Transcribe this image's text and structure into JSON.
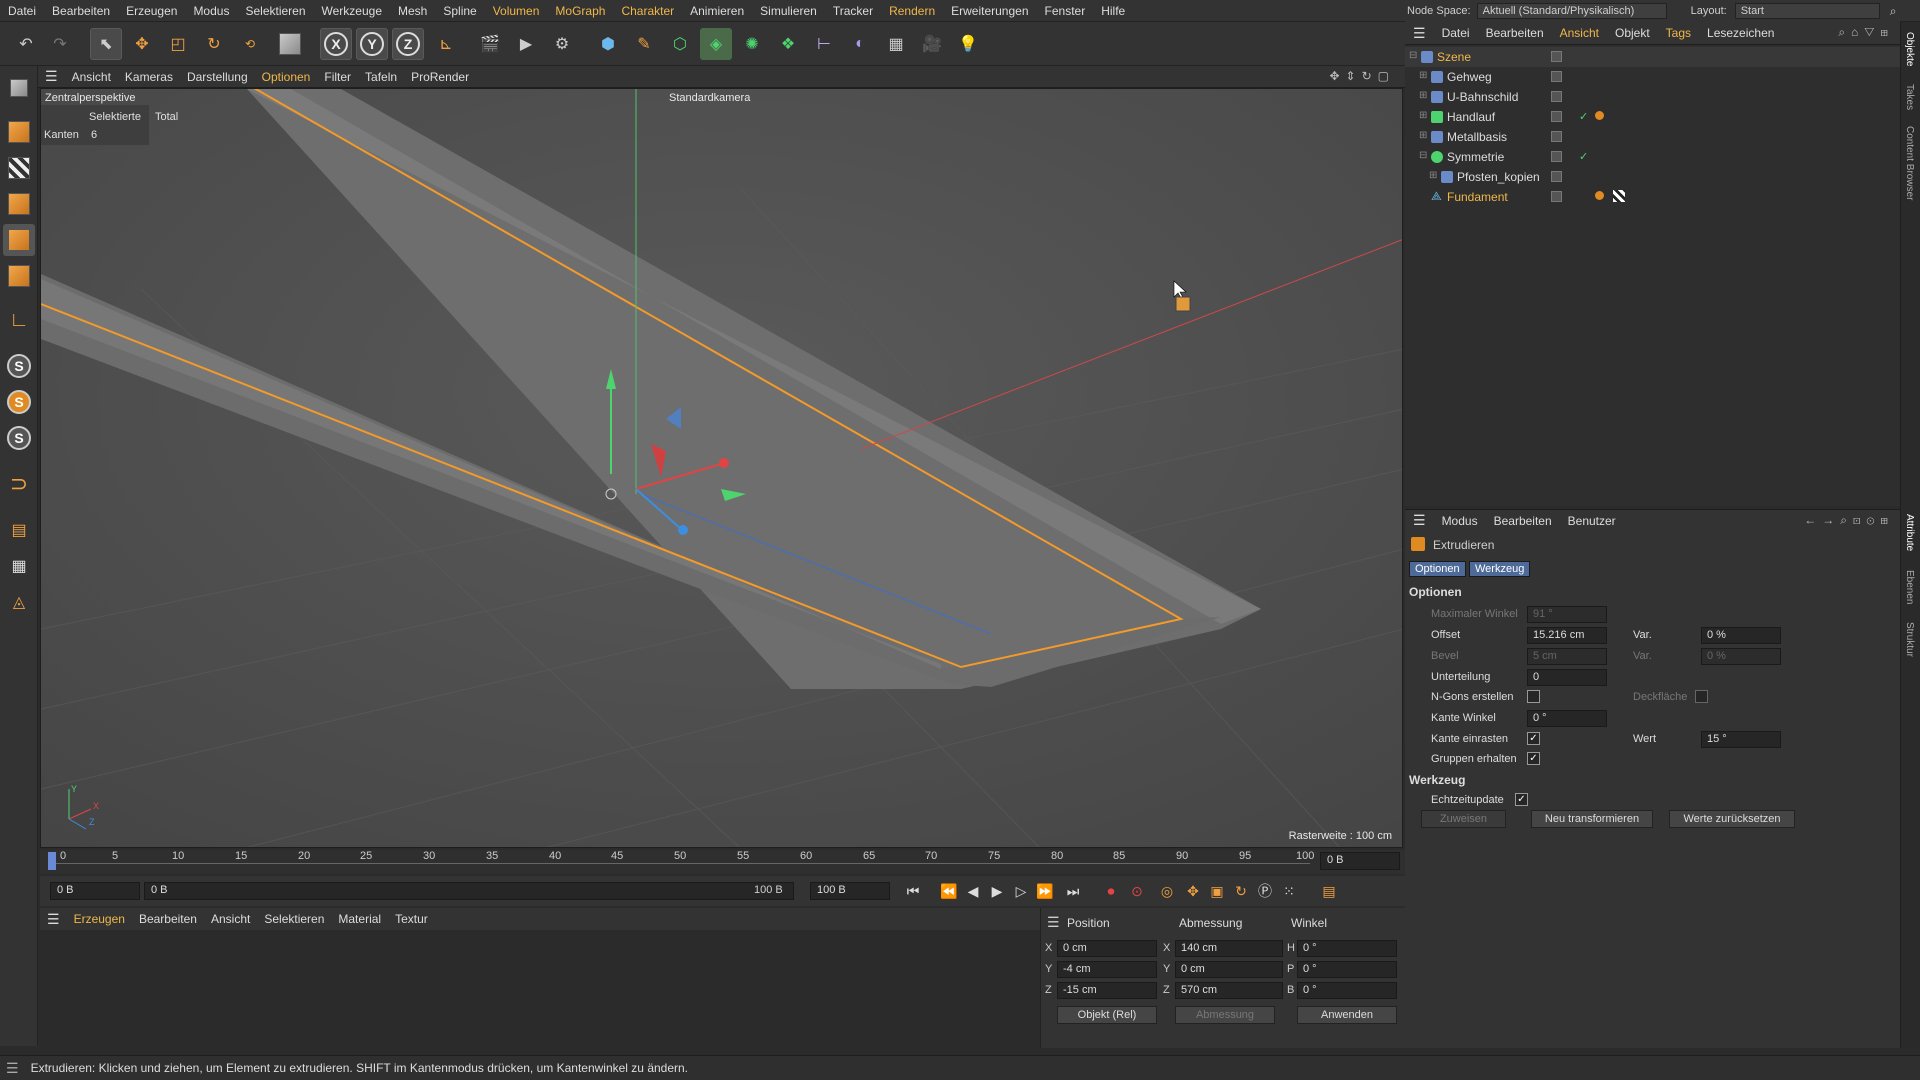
{
  "menubar": {
    "items": [
      "Datei",
      "Bearbeiten",
      "Erzeugen",
      "Modus",
      "Selektieren",
      "Werkzeuge",
      "Mesh",
      "Spline",
      "Volumen",
      "MoGraph",
      "Charakter",
      "Animieren",
      "Simulieren",
      "Tracker",
      "Rendern",
      "Erweiterungen",
      "Fenster",
      "Hilfe"
    ],
    "node_space_label": "Node Space:",
    "node_space_value": "Aktuell (Standard/Physikalisch)",
    "layout_label": "Layout:",
    "layout_value": "Start"
  },
  "toolbar": {
    "x_label": "X",
    "y_label": "Y",
    "z_label": "Z"
  },
  "viewport": {
    "menu": [
      "Ansicht",
      "Kameras",
      "Darstellung",
      "Optionen",
      "Filter",
      "Tafeln",
      "ProRender"
    ],
    "active_menu": "Optionen",
    "view_name": "Zentralperspektive",
    "camera_name": "Standardkamera",
    "info_col1": "Selektierte",
    "info_col2": "Total",
    "info_row_label": "Kanten",
    "info_row_value": "6",
    "grid_label": "Rasterweite : 100 cm",
    "axis_y": "Y",
    "axis_x": "X",
    "axis_z": "Z"
  },
  "timeline": {
    "ticks": [
      "0",
      "5",
      "10",
      "15",
      "20",
      "25",
      "30",
      "35",
      "40",
      "45",
      "50",
      "55",
      "60",
      "65",
      "70",
      "75",
      "80",
      "85",
      "90",
      "95",
      "100"
    ],
    "current_frame": "0 B",
    "start_frame": "0 B",
    "range_start": "0 B",
    "range_end": "100 B",
    "end_frame": "100 B"
  },
  "material_menu": {
    "items": [
      "Erzeugen",
      "Bearbeiten",
      "Ansicht",
      "Selektieren",
      "Material",
      "Textur"
    ],
    "active": "Erzeugen"
  },
  "coordinates": {
    "headers": [
      "Position",
      "Abmessung",
      "Winkel"
    ],
    "rows": [
      {
        "axis": "X",
        "pos": "0 cm",
        "size_axis": "X",
        "size": "140 cm",
        "rot_axis": "H",
        "rot": "0 °"
      },
      {
        "axis": "Y",
        "pos": "-4 cm",
        "size_axis": "Y",
        "size": "0 cm",
        "rot_axis": "P",
        "rot": "0 °"
      },
      {
        "axis": "Z",
        "pos": "-15 cm",
        "size_axis": "Z",
        "size": "570 cm",
        "rot_axis": "B",
        "rot": "0 °"
      }
    ],
    "mode_select": "Objekt (Rel)",
    "size_select": "Abmessung",
    "apply_button": "Anwenden"
  },
  "object_manager": {
    "menu": [
      "Datei",
      "Bearbeiten",
      "Ansicht",
      "Objekt",
      "Tags",
      "Lesezeichen"
    ],
    "active_menu": "Ansicht",
    "objects": [
      {
        "name": "Szene",
        "color": "#f0b84a"
      },
      {
        "name": "Gehweg",
        "color": "#dddddd"
      },
      {
        "name": "U-Bahnschild",
        "color": "#dddddd"
      },
      {
        "name": "Handlauf",
        "color": "#dddddd"
      },
      {
        "name": "Metallbasis",
        "color": "#dddddd"
      },
      {
        "name": "Symmetrie",
        "color": "#dddddd"
      },
      {
        "name": "Pfosten_kopien",
        "color": "#dddddd"
      },
      {
        "name": "Fundament",
        "color": "#f0b84a"
      }
    ]
  },
  "attributes": {
    "menu": [
      "Modus",
      "Bearbeiten",
      "Benutzer"
    ],
    "tool_name": "Extrudieren",
    "tabs": [
      "Optionen",
      "Werkzeug"
    ],
    "section_options": "Optionen",
    "max_angle_label": "Maximaler Winkel",
    "max_angle_value": "91 °",
    "offset_label": "Offset",
    "offset_value": "15.216 cm",
    "var_label": "Var.",
    "var_value": "0 %",
    "bevel_label": "Bevel",
    "bevel_value": "5 cm",
    "var2_label": "Var.",
    "var2_value": "0 %",
    "subdiv_label": "Unterteilung",
    "subdiv_value": "0",
    "ngons_label": "N-Gons erstellen",
    "cap_label": "Deckfläche",
    "edge_angle_label": "Kante Winkel",
    "edge_angle_value": "0 °",
    "edge_snap_label": "Kante einrasten",
    "value_label": "Wert",
    "value_value": "15 °",
    "keep_groups_label": "Gruppen erhalten",
    "section_tool": "Werkzeug",
    "realtime_label": "Echtzeitupdate",
    "assign_button": "Zuweisen",
    "new_transform_button": "Neu transformieren",
    "reset_button": "Werte zurücksetzen"
  },
  "side_tabs": [
    "Objekte",
    "Takes",
    "Content Browser",
    "Attribute",
    "Ebenen",
    "Struktur"
  ],
  "status": {
    "text": "Extrudieren: Klicken und ziehen, um Element zu extrudieren. SHIFT im Kantenmodus drücken, um Kantenwinkel zu ändern."
  },
  "colors": {
    "accent": "#f0b84a",
    "selection_edge": "#f39a2a",
    "viewport_bg": "#4f4f4f"
  }
}
